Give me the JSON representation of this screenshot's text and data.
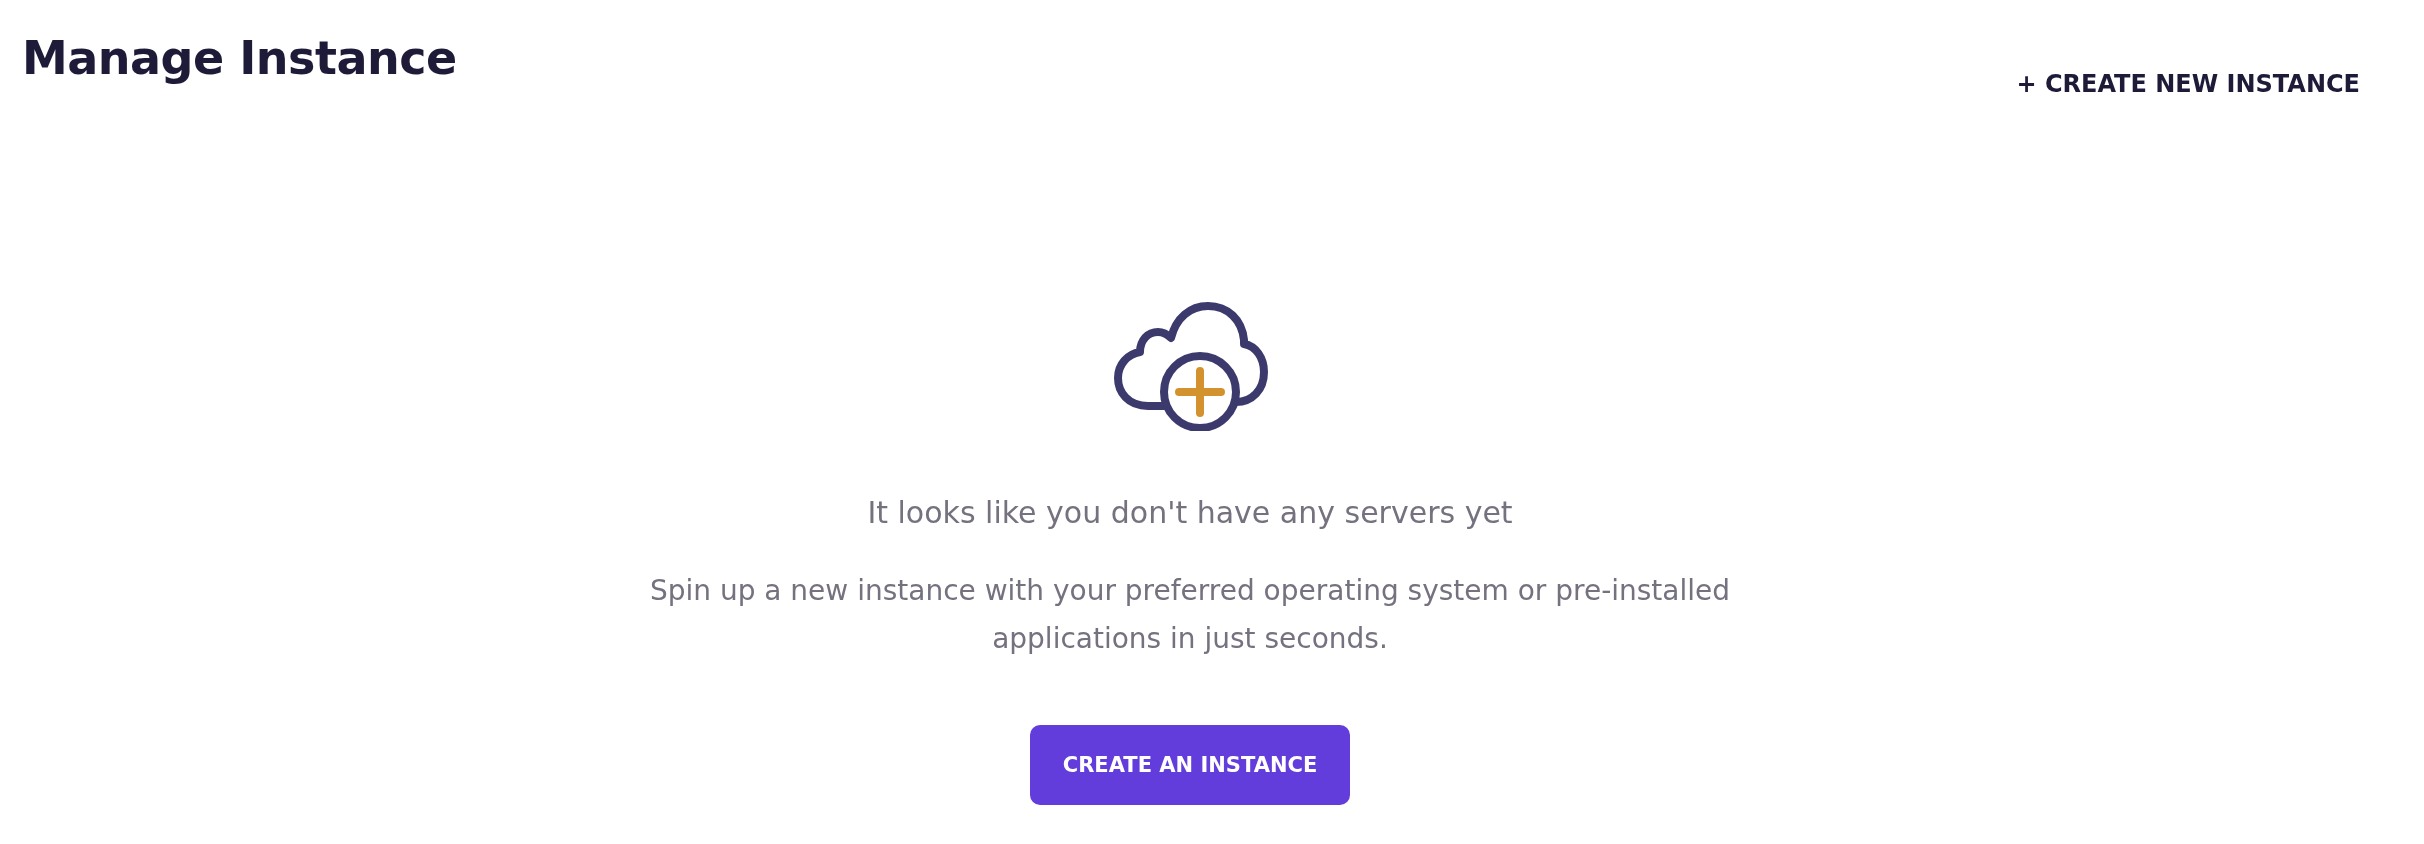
{
  "header": {
    "title": "Manage Instance",
    "action": "+ CREATE NEW INSTANCE"
  },
  "empty_state": {
    "heading": "It looks like you don't have any servers yet",
    "description": "Spin up a new instance with your preferred operating system or pre-installed applications in just seconds.",
    "button": "CREATE AN INSTANCE"
  }
}
